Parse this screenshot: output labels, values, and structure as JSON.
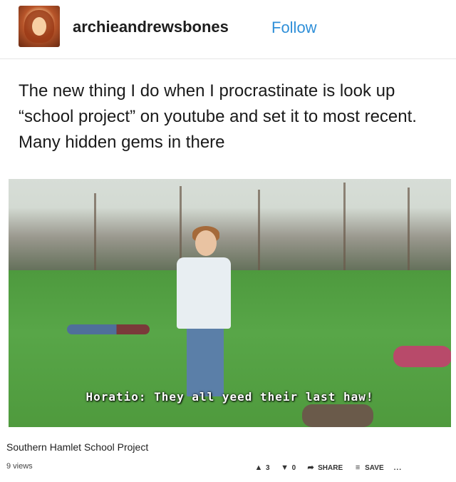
{
  "header": {
    "username": "archieandrewsbones",
    "follow_label": "Follow"
  },
  "post": {
    "text": "The new thing I do when I procrastinate is look up “school project” on youtube and set it to most recent. Many hidden gems in there"
  },
  "video": {
    "subtitle": "Horatio: They all yeed their last haw!",
    "title": "Southern Hamlet School Project",
    "views": "9 views",
    "likes": "3",
    "dislikes": "0",
    "share_label": "SHARE",
    "save_label": "SAVE",
    "more_label": "..."
  },
  "colors": {
    "follow": "#2f8fd8",
    "grass": "#4e9a3e"
  }
}
